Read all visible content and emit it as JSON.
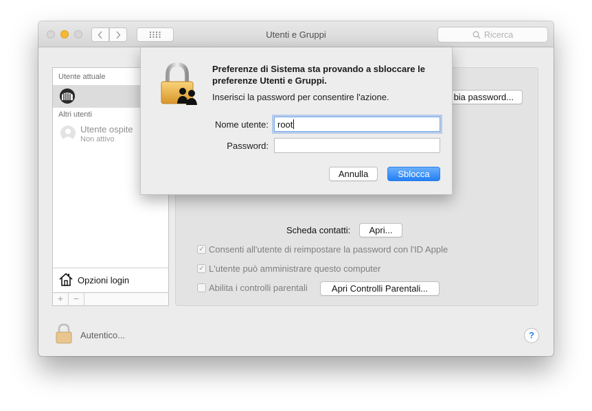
{
  "window": {
    "title": "Utenti e Gruppi"
  },
  "toolbar": {
    "search_placeholder": "Ricerca"
  },
  "sidebar": {
    "current_header": "Utente attuale",
    "other_header": "Altri utenti",
    "guest": {
      "name": "Utente ospite",
      "status": "Non attivo"
    },
    "login_options": "Opzioni login",
    "add_symbol": "+",
    "remove_symbol": "−"
  },
  "main": {
    "change_password_button": "bia password...",
    "contact_card_label": "Scheda contatti:",
    "open_button": "Apri...",
    "checkboxes": [
      {
        "label": "Consenti all'utente di reimpostare la password con l'ID Apple",
        "checked": true
      },
      {
        "label": "L'utente può amministrare questo computer",
        "checked": true
      },
      {
        "label": "Abilita i controlli parentali",
        "checked": false
      }
    ],
    "parental_button": "Apri Controlli Parentali..."
  },
  "footer": {
    "auth_label": "Autentico...",
    "help_symbol": "?"
  },
  "dialog": {
    "title": "Preferenze di Sistema sta provando a sbloccare le preferenze Utenti e Gruppi.",
    "message": "Inserisci la password per consentire l'azione.",
    "username_label": "Nome utente:",
    "username_value": "root",
    "password_label": "Password:",
    "password_value": "",
    "cancel_button": "Annulla",
    "unlock_button": "Sblocca"
  },
  "colors": {
    "accent": "#237ff5",
    "traffic_yellow": "#f7b92f",
    "window_bg": "#ececec"
  }
}
